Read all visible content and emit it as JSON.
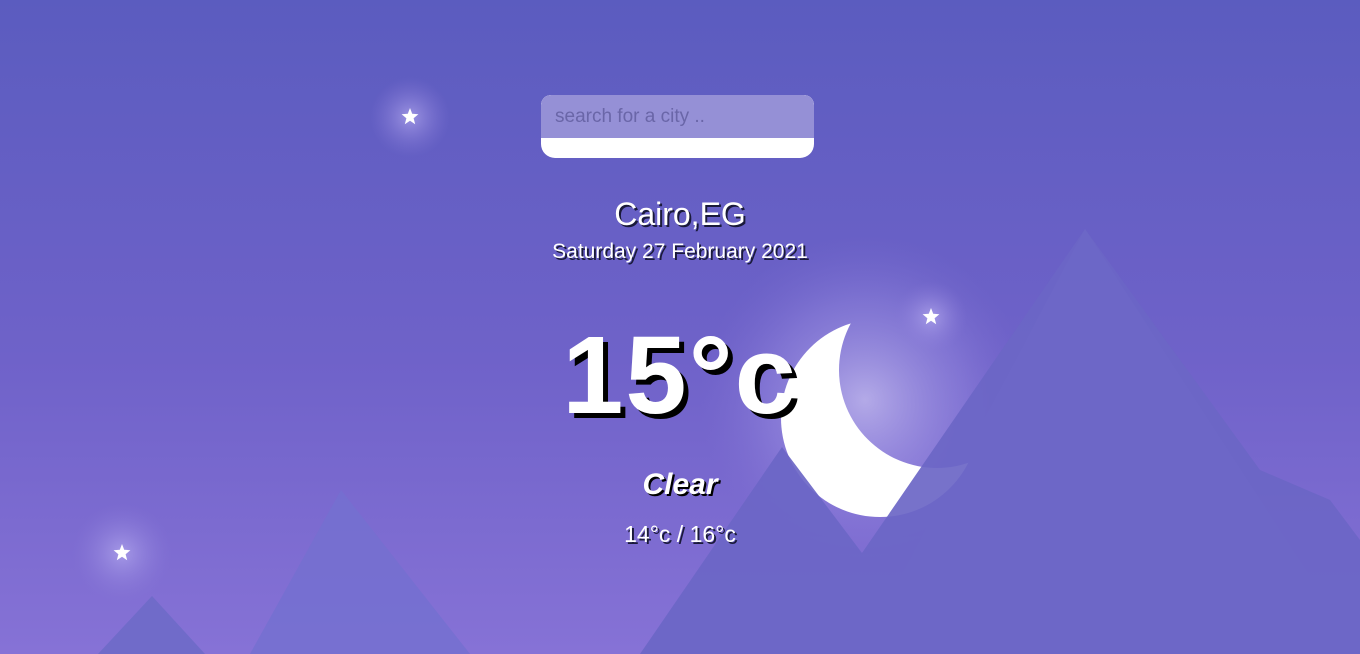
{
  "search": {
    "placeholder": "search for a city ..",
    "value": ""
  },
  "location": {
    "city": "Cairo,EG",
    "date": "Saturday 27 February 2021"
  },
  "weather": {
    "temperature": "15°c",
    "condition": "Clear",
    "hi_low": "14°c / 16°c"
  },
  "theme": {
    "background_top": "#5b5cbf",
    "background_bottom": "#8672d6",
    "moon": "#ffffff",
    "mountain": "#6b66c6"
  },
  "icons": [
    "star-icon",
    "moon-icon",
    "mountain-shape"
  ]
}
